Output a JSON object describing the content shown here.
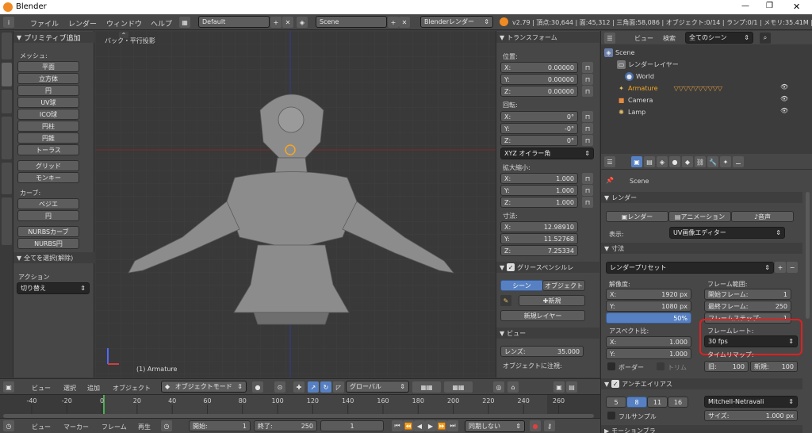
{
  "window": {
    "title": "Blender",
    "minimize": "—",
    "maximize": "❐",
    "close": "✕"
  },
  "menu": {
    "file": "ファイル",
    "render": "レンダー",
    "window": "ウィンドウ",
    "help": "ヘルプ",
    "layout": "Default",
    "scene": "Scene",
    "engine": "Blenderレンダー",
    "stats": "v2.79 | 頂点:30,644 | 面:45,312 | 三角面:58,086 | オブジェクト:0/14 | ランプ:0/1 | メモリ:35.41M | Arma"
  },
  "toolshelf": {
    "header": "プリミティブ追加",
    "mesh_label": "メッシュ:",
    "mesh": [
      "平面",
      "立方体",
      "円",
      "UV球",
      "ICO球",
      "円柱",
      "円錐",
      "トーラス"
    ],
    "grid": "グリッド",
    "monkey": "モンキー",
    "curve_label": "カーブ:",
    "curves": [
      "ベジエ",
      "円"
    ],
    "nurbs": [
      "NURBSカーブ",
      "NURBS円"
    ],
    "tabs": [
      "ツール",
      "作成",
      "関係",
      "アニメーション",
      "物理演算",
      "グリースペンシル"
    ],
    "op_header": "全てを選択(解除)",
    "action_label": "アクション",
    "action_value": "切り替え"
  },
  "viewport": {
    "view_label": "バック・平行投影",
    "object_name": "(1) Armature",
    "menu": [
      "ビュー",
      "選択",
      "追加",
      "オブジェクト"
    ],
    "mode": "オブジェクトモード",
    "orientation": "グローバル"
  },
  "npanel": {
    "transform": "トランスフォーム",
    "location": "位置:",
    "loc": [
      {
        "axis": "X:",
        "value": "0.00000"
      },
      {
        "axis": "Y:",
        "value": "0.00000"
      },
      {
        "axis": "Z:",
        "value": "0.00000"
      }
    ],
    "rotation": "回転:",
    "rot": [
      {
        "axis": "X:",
        "value": "0°"
      },
      {
        "axis": "Y:",
        "value": "-0°"
      },
      {
        "axis": "Z:",
        "value": "0°"
      }
    ],
    "rot_mode": "XYZ オイラー角",
    "scale": "拡大縮小:",
    "scl": [
      {
        "axis": "X:",
        "value": "1.000"
      },
      {
        "axis": "Y:",
        "value": "1.000"
      },
      {
        "axis": "Z:",
        "value": "1.000"
      }
    ],
    "dimensions": "寸法:",
    "dim": [
      {
        "axis": "X:",
        "value": "12.98910"
      },
      {
        "axis": "Y:",
        "value": "11.52768"
      },
      {
        "axis": "Z:",
        "value": "7.25334"
      }
    ],
    "gp_header": "グリースペンシルレ",
    "gp_scene": "シーン",
    "gp_object": "オブジェクト",
    "gp_new": "新規",
    "gp_new_layer": "新規レイヤー",
    "view_header": "ビュー",
    "lens_label": "レンズ:",
    "lens_value": "35.000",
    "lock_label": "オブジェクトに注視:"
  },
  "outliner": {
    "view": "ビュー",
    "search": "検索",
    "filter": "全てのシーン",
    "items": [
      {
        "name": "Scene"
      },
      {
        "name": "レンダーレイヤー"
      },
      {
        "name": "World"
      },
      {
        "name": "Armature"
      },
      {
        "name": "Camera"
      },
      {
        "name": "Lamp"
      }
    ]
  },
  "properties": {
    "scene_label": "Scene",
    "render_header": "レンダー",
    "render_btn": "レンダー",
    "anim_btn": "アニメーション",
    "audio_btn": "音声",
    "display_label": "表示:",
    "display_value": "UV画像エディター",
    "dim_header": "寸法",
    "preset": "レンダープリセット",
    "resolution_label": "解像度:",
    "res_x": {
      "axis": "X:",
      "value": "1920 px"
    },
    "res_y": {
      "axis": "Y:",
      "value": "1080 px"
    },
    "res_pct": "50%",
    "frame_range_label": "フレーム範囲:",
    "start_frame": {
      "label": "開始フレーム:",
      "value": "1"
    },
    "end_frame": {
      "label": "最終フレーム:",
      "value": "250"
    },
    "frame_step": {
      "label": "フレームステップ:",
      "value": "1"
    },
    "aspect_label": "アスペクト比:",
    "asp_x": {
      "axis": "X:",
      "value": "1.000"
    },
    "asp_y": {
      "axis": "Y:",
      "value": "1.000"
    },
    "framerate_label": "フレームレート:",
    "framerate_value": "30 fps",
    "timeremap_label": "タイムリマップ:",
    "border": "ボーダー",
    "crop": "トリム",
    "old": {
      "label": "旧:",
      "value": "100"
    },
    "new": {
      "label": "新規:",
      "value": "100"
    },
    "aa_header": "アンチエイリアス",
    "aa_samples": [
      "5",
      "8",
      "11",
      "16"
    ],
    "aa_filter": "Mitchell-Netravali",
    "full_sample": "フルサンプル",
    "size": {
      "label": "サイズ:",
      "value": "1.000 px"
    },
    "next_header": "モーションブラ"
  },
  "timeline": {
    "ruler": [
      "-40",
      "-20",
      "0",
      "20",
      "40",
      "60",
      "80",
      "100",
      "120",
      "140",
      "160",
      "180",
      "200",
      "220",
      "240",
      "260"
    ],
    "menu": [
      "ビュー",
      "マーカー",
      "フレーム",
      "再生"
    ],
    "start": {
      "label": "開始:",
      "value": "1"
    },
    "end": {
      "label": "終了:",
      "value": "250"
    },
    "current": "1",
    "sync": "同期しない"
  },
  "colors": {
    "accent": "#5680c2",
    "selected": "#f5a623",
    "highlight": "#e02020"
  }
}
